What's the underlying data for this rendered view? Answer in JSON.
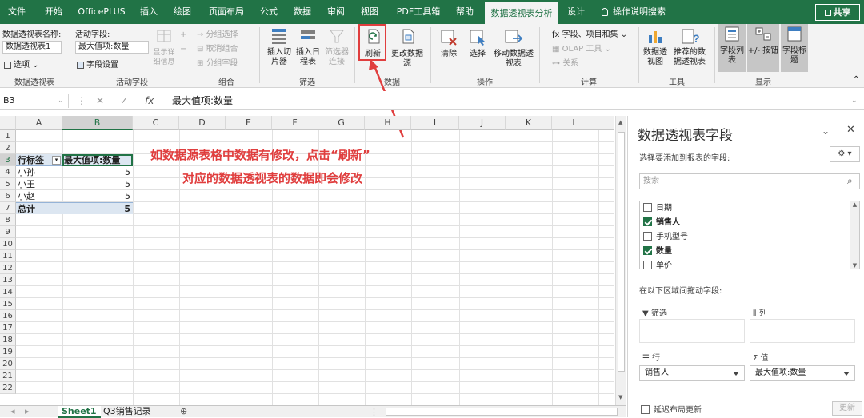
{
  "menu": {
    "tabs": [
      "文件",
      "开始",
      "OfficePLUS",
      "插入",
      "绘图",
      "页面布局",
      "公式",
      "数据",
      "审阅",
      "视图",
      "PDF工具箱",
      "帮助",
      "数据透视表分析",
      "设计"
    ],
    "tell_me": "操作说明搜索",
    "share": "共享"
  },
  "ribbon": {
    "pivot_group": {
      "name_label": "数据透视表名称:",
      "name_value": "数据透视表1",
      "options_label": "选项",
      "group_label": "数据透视表"
    },
    "active_field_group": {
      "label": "活动字段:",
      "value": "最大值项:数量",
      "settings_label": "字段设置",
      "drill_down": "向下钻取",
      "drill_up": "向上钻取",
      "expand": "展开字段",
      "collapse": "折叠字段",
      "show_detail": "显示详细信息",
      "group_label": "活动字段"
    },
    "group_group": {
      "selection": "分组选择",
      "ungroup": "取消组合",
      "field": "分组字段",
      "group_label": "组合"
    },
    "filter_group": {
      "slicer": "插入切片器",
      "timeline": "插入日程表",
      "connections": "筛选器连接",
      "group_label": "筛选"
    },
    "data_group": {
      "refresh": "刷新",
      "change_source": "更改数据源",
      "group_label": "数据"
    },
    "actions_group": {
      "clear": "清除",
      "select": "选择",
      "move": "移动数据透视表",
      "group_label": "操作"
    },
    "calc_group": {
      "fields_items": "字段、项目和集",
      "olap": "OLAP 工具",
      "relationships": "关系",
      "group_label": "计算"
    },
    "tools_group": {
      "pivotchart": "数据透视图",
      "recommended": "推荐的数据透视表",
      "group_label": "工具"
    },
    "show_group": {
      "field_list": "字段列表",
      "buttons": "+/- 按钮",
      "headers": "字段标题",
      "group_label": "显示"
    }
  },
  "formula_bar": {
    "name_box": "B3",
    "value": "最大值项:数量"
  },
  "sheet": {
    "columns": [
      "A",
      "B",
      "C",
      "D",
      "E",
      "F",
      "G",
      "H",
      "I",
      "J",
      "K",
      "L"
    ],
    "rows": [
      "1",
      "2",
      "3",
      "4",
      "5",
      "6",
      "7",
      "8",
      "9",
      "10",
      "11",
      "12",
      "13",
      "14",
      "15",
      "16",
      "17",
      "18",
      "19",
      "20",
      "21",
      "22"
    ],
    "pivot": {
      "row_header": "行标签",
      "value_header": "最大值项:数量",
      "rows": [
        {
          "label": "小孙",
          "value": "5"
        },
        {
          "label": "小王",
          "value": "5"
        },
        {
          "label": "小赵",
          "value": "5"
        }
      ],
      "total_label": "总计",
      "total_value": "5"
    },
    "tabs": [
      "Sheet1",
      "Q3销售记录"
    ]
  },
  "annotation": {
    "line1": "如数据源表格中数据有修改，点击“刷新”",
    "line2": "对应的数据透视表的数据即会修改",
    "color": "#e03e3e"
  },
  "field_pane": {
    "title": "数据透视表字段",
    "choose_label": "选择要添加到报表的字段:",
    "search_placeholder": "搜索",
    "fields": [
      {
        "name": "日期",
        "checked": false
      },
      {
        "name": "销售人",
        "checked": true
      },
      {
        "name": "手机型号",
        "checked": false
      },
      {
        "name": "数量",
        "checked": true
      },
      {
        "name": "单价",
        "checked": false
      }
    ],
    "drag_label": "在以下区域间拖动字段:",
    "areas": {
      "filter": "筛选",
      "columns": "列",
      "rows": "行",
      "values": "值",
      "rows_item": "销售人",
      "values_item": "最大值项:数量"
    },
    "defer_label": "延迟布局更新",
    "update_button": "更新"
  }
}
